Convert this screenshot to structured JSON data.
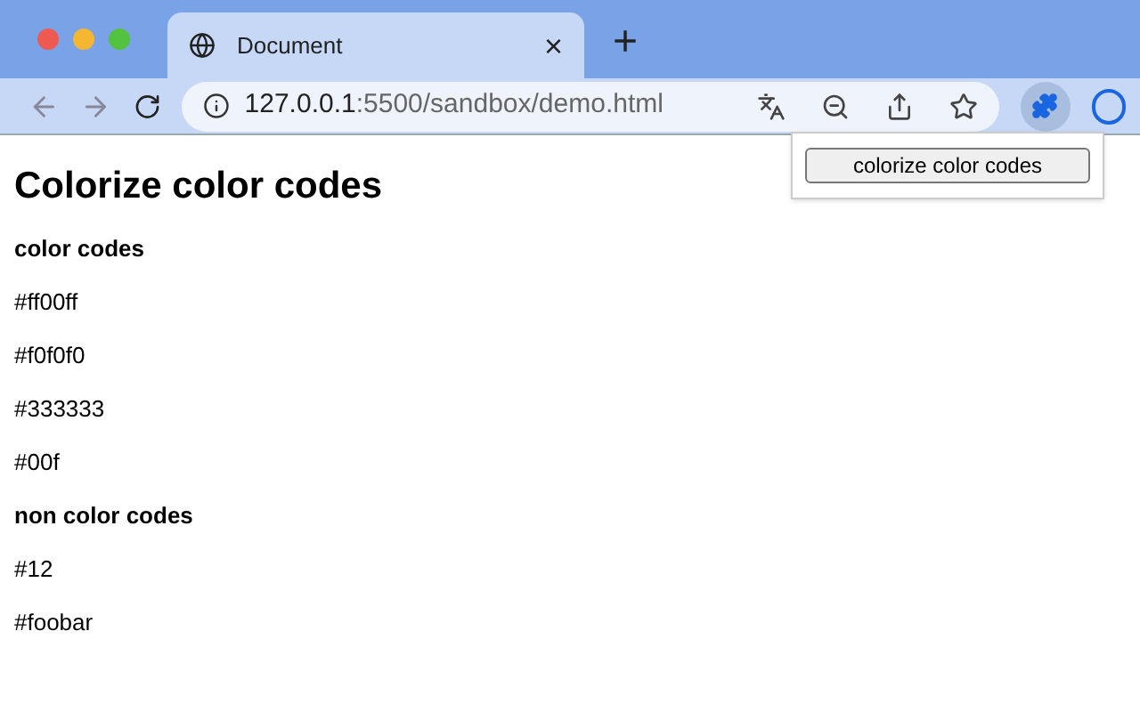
{
  "tab": {
    "title": "Document",
    "close": "×",
    "new_tab": "+"
  },
  "address_bar": {
    "host": "127.0.0.1",
    "path": ":5500/sandbox/demo.html"
  },
  "popup": {
    "button": "colorize color codes"
  },
  "page": {
    "title": "Colorize color codes",
    "sections": [
      {
        "heading": "color codes",
        "items": [
          "#ff00ff",
          "#f0f0f0",
          "#333333",
          "#00f"
        ]
      },
      {
        "heading": "non color codes",
        "items": [
          "#12",
          "#foobar"
        ]
      }
    ]
  }
}
